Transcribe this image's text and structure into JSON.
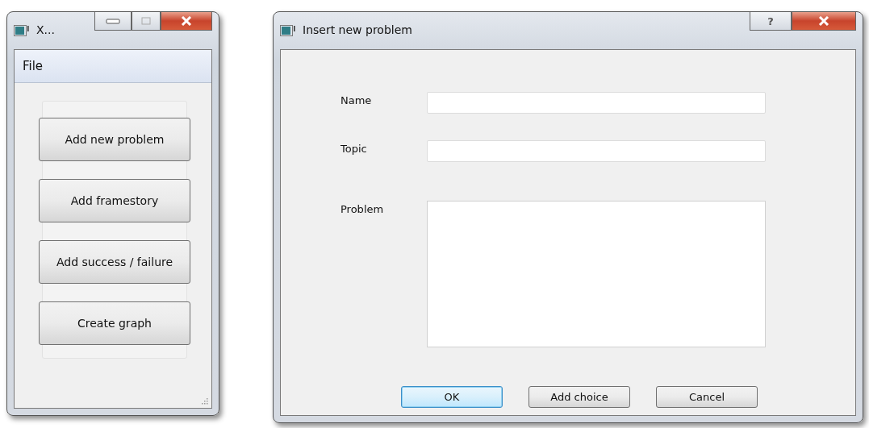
{
  "main_window": {
    "title": "X...",
    "menu": [
      "File"
    ],
    "buttons": [
      "Add new problem",
      "Add framestory",
      "Add success / failure",
      "Create graph"
    ]
  },
  "dialog": {
    "title": "Insert new problem",
    "help_button": "?",
    "fields": [
      {
        "label": "Name",
        "kind": "line"
      },
      {
        "label": "Topic",
        "kind": "line"
      },
      {
        "label": "Problem",
        "kind": "area"
      }
    ],
    "buttons": [
      {
        "label": "OK",
        "default": true
      },
      {
        "label": "Add choice",
        "default": false
      },
      {
        "label": "Cancel",
        "default": false
      }
    ]
  }
}
